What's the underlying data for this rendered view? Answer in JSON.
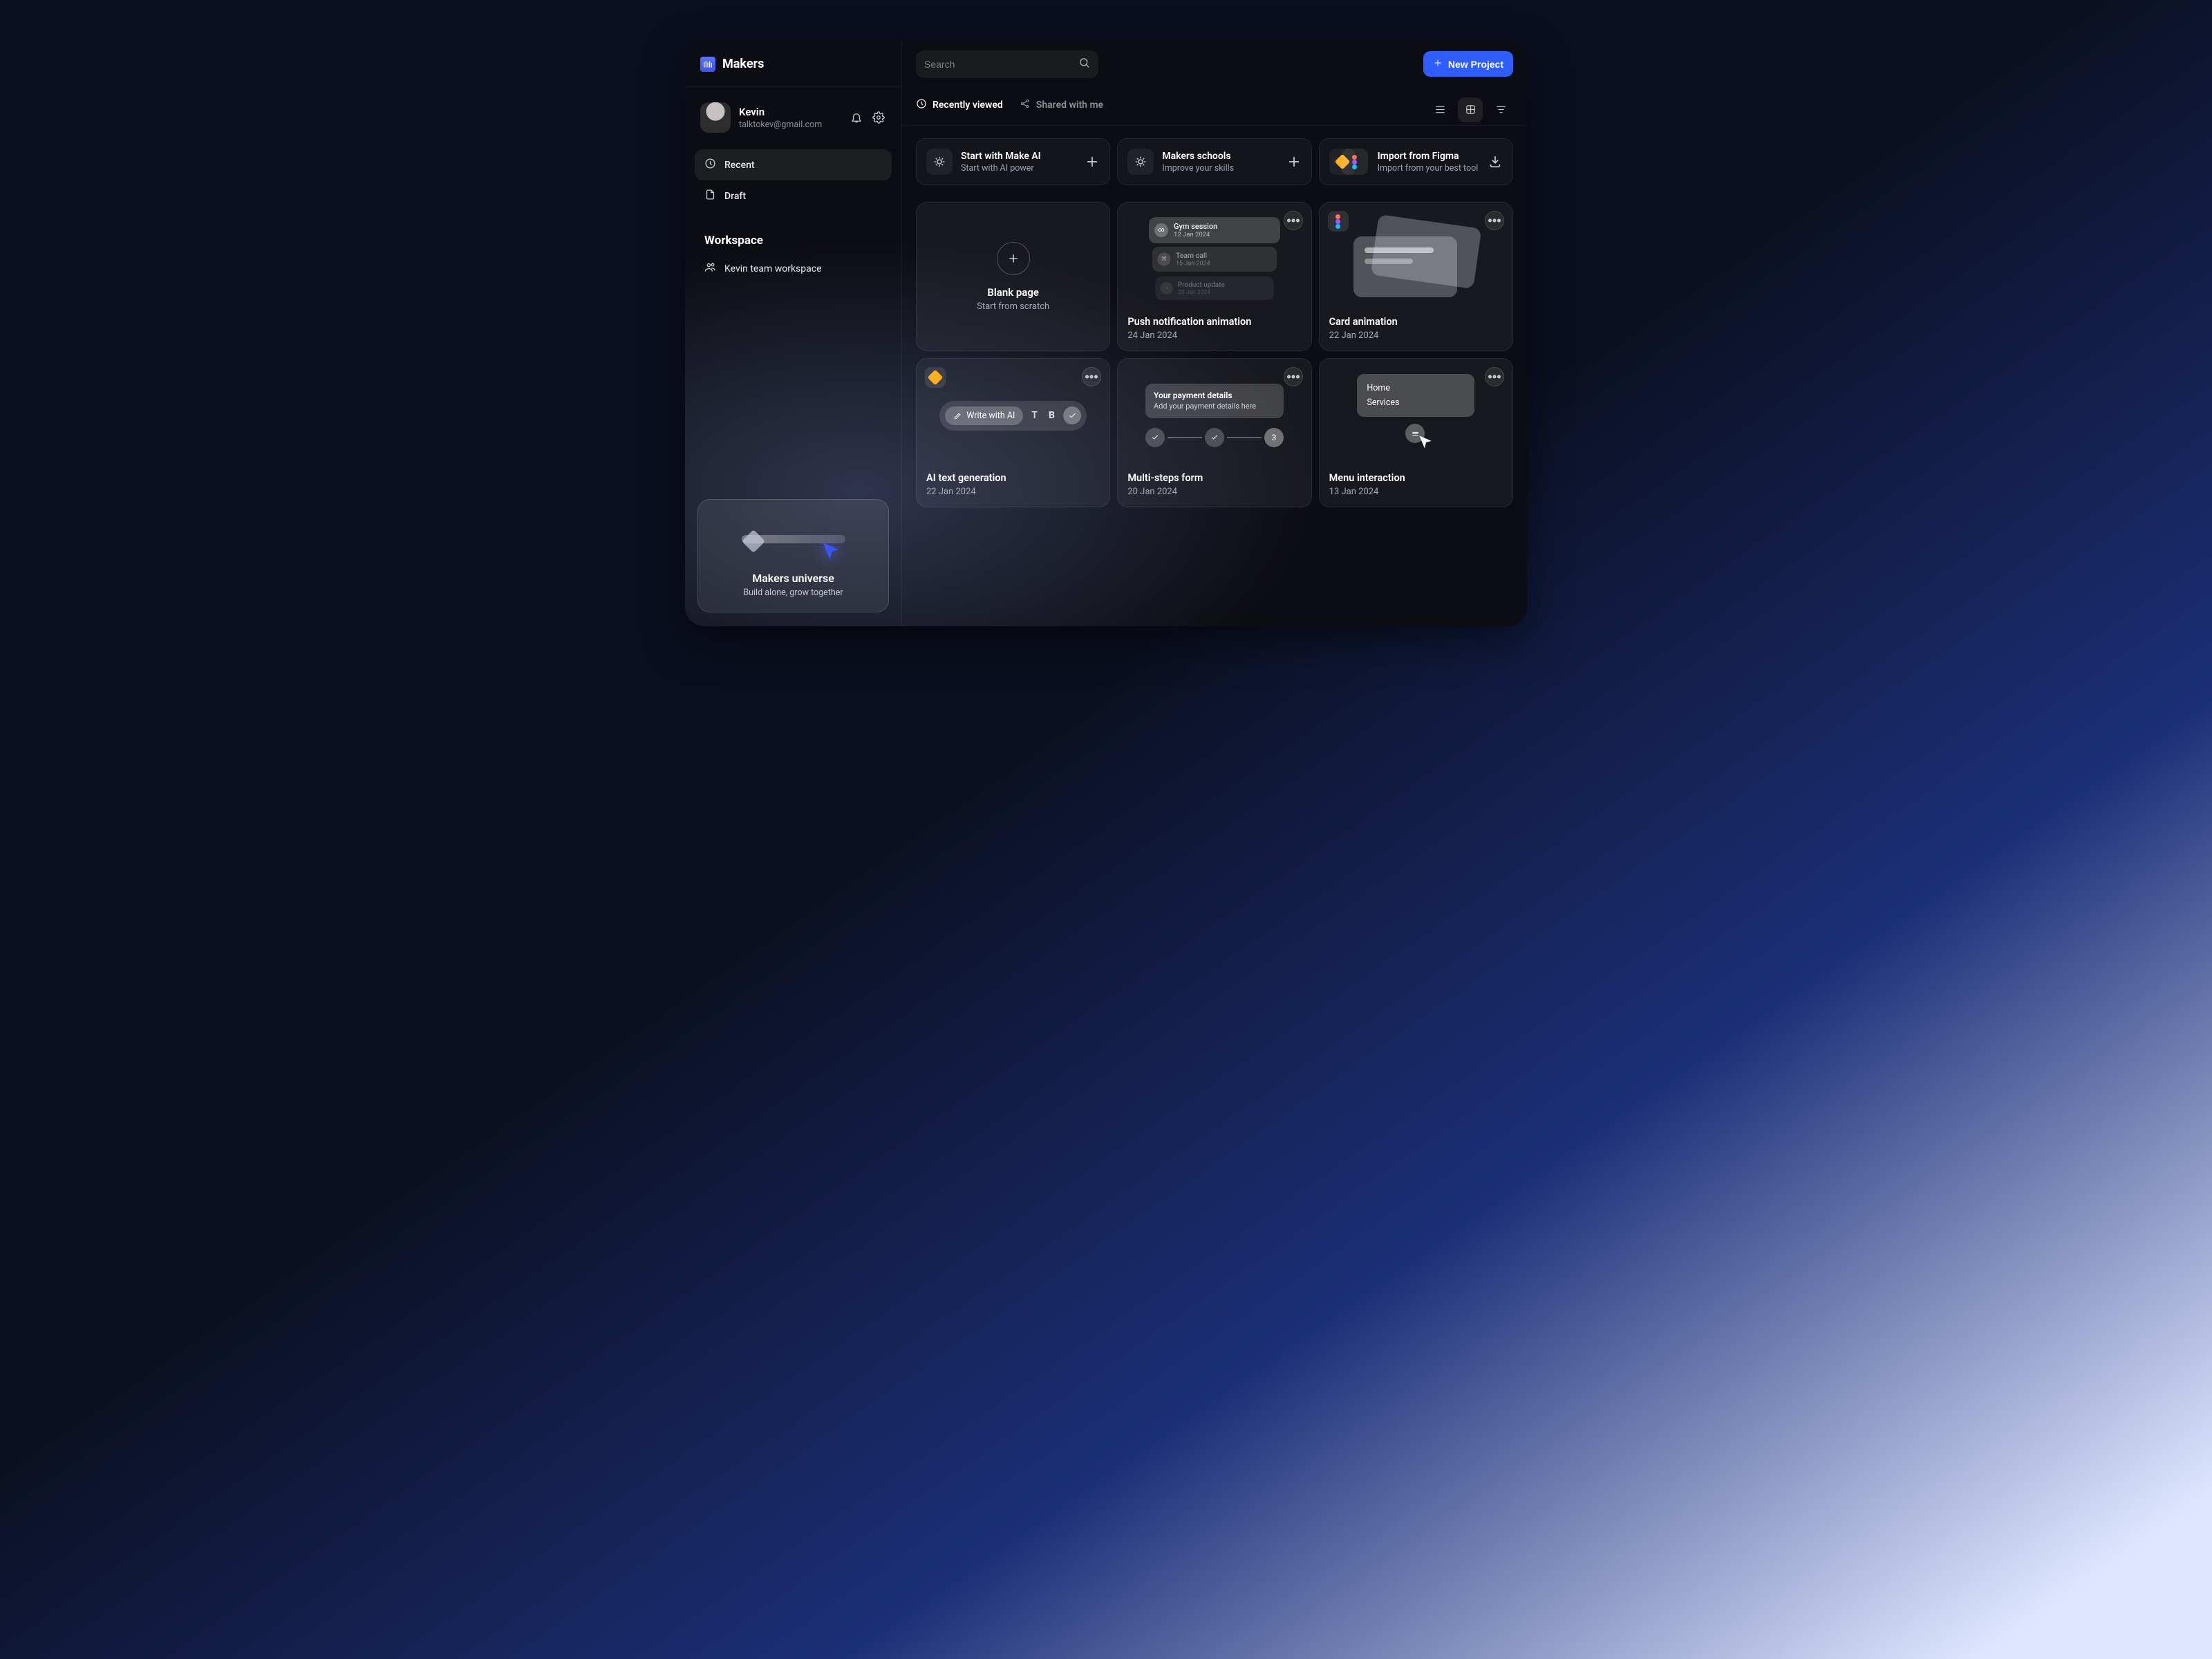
{
  "brand": {
    "name": "Makers"
  },
  "user": {
    "name": "Kevin",
    "email": "talktokev@gmail.com"
  },
  "sidebar": {
    "nav": [
      {
        "label": "Recent",
        "icon": "clock-icon",
        "active": true
      },
      {
        "label": "Draft",
        "icon": "file-icon",
        "active": false
      }
    ],
    "workspace_heading": "Workspace",
    "workspaces": [
      {
        "label": "Kevin team workspace"
      }
    ],
    "promo": {
      "title": "Makers universe",
      "subtitle": "Build alone, grow together"
    }
  },
  "search": {
    "placeholder": "Search"
  },
  "new_project_label": "New Project",
  "tabs": {
    "recent": "Recently viewed",
    "shared": "Shared with me"
  },
  "quick": [
    {
      "title": "Start with Make AI",
      "subtitle": "Start with AI power",
      "action": "plus"
    },
    {
      "title": "Makers schools",
      "subtitle": "Improve your skills",
      "action": "plus"
    },
    {
      "title": "Import from Figma",
      "subtitle": "Import from your best tool",
      "action": "download"
    }
  ],
  "blank_card": {
    "title": "Blank page",
    "subtitle": "Start from scratch"
  },
  "projects": [
    {
      "title": "Push notification animation",
      "date": "24 Jan 2024",
      "preview": {
        "type": "notifications",
        "items": [
          {
            "title": "Gym session",
            "date": "12 Jan 2024"
          },
          {
            "title": "Team call",
            "date": "15 Jan 2024"
          },
          {
            "title": "Product update",
            "date": "20 Jan 2024"
          }
        ]
      }
    },
    {
      "title": "Card animation",
      "date": "22 Jan 2024",
      "badge": "figma",
      "preview": {
        "type": "cards"
      }
    },
    {
      "title": "AI text generation",
      "date": "22 Jan 2024",
      "badge": "sketch",
      "preview": {
        "type": "ai",
        "chip": "Write with AI",
        "letters": [
          "T",
          "B"
        ]
      }
    },
    {
      "title": "Multi-steps form",
      "date": "20 Jan 2024",
      "preview": {
        "type": "multisteps",
        "panel_title": "Your payment details",
        "panel_sub": "Add your payment details here",
        "step_last": "3"
      }
    },
    {
      "title": "Menu interaction",
      "date": "13 Jan 2024",
      "preview": {
        "type": "menu",
        "items": [
          "Home",
          "Services"
        ]
      }
    }
  ]
}
